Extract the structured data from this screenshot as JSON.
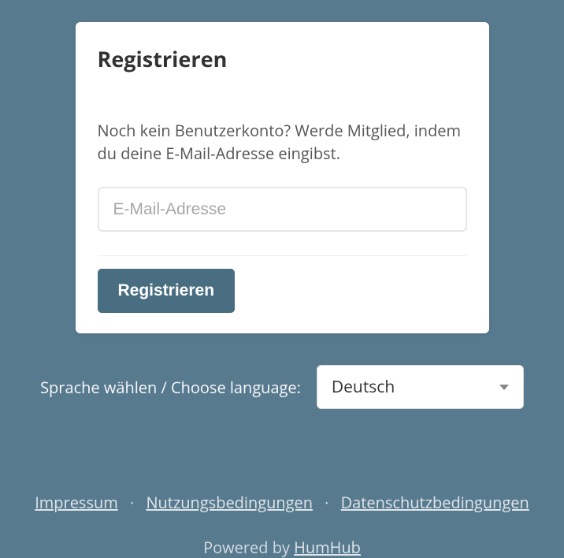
{
  "panel": {
    "title": "Registrieren",
    "description": "Noch kein Benutzerkonto? Werde Mitglied, indem du deine E-Mail-Adresse eingibst.",
    "email_placeholder": "E-Mail-Adresse",
    "submit_label": "Registrieren"
  },
  "language": {
    "label": "Sprache wählen / Choose language:",
    "selected": "Deutsch"
  },
  "footer": {
    "links": {
      "imprint": "Impressum",
      "terms": "Nutzungsbedingungen",
      "privacy": "Datenschutzbedingungen"
    },
    "powered_prefix": "Powered by ",
    "powered_link": "HumHub"
  }
}
